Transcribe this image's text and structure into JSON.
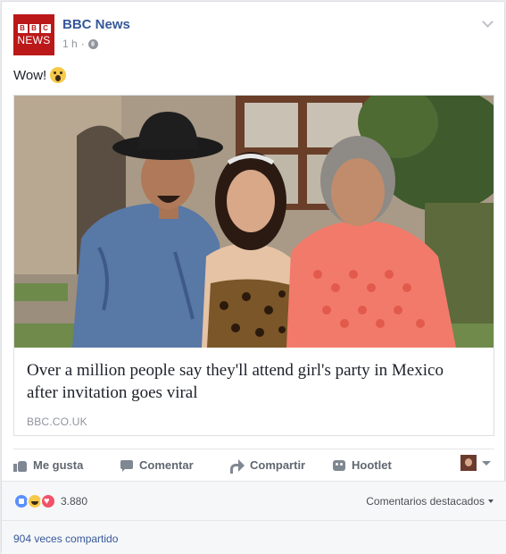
{
  "post": {
    "page_name": "BBC News",
    "avatar": {
      "logo_letters": [
        "B",
        "B",
        "C"
      ],
      "logo_word": "NEWS",
      "brand_color": "#bb1919"
    },
    "timestamp": "1 h",
    "separator": "·",
    "audience_icon": "globe-icon",
    "text": "Wow!",
    "text_emoji": "wow-emoji"
  },
  "link": {
    "title": "Over a million people say they'll attend girl's party in Mexico after invitation goes viral",
    "domain": "BBC.CO.UK"
  },
  "actions": {
    "like": "Me gusta",
    "comment": "Comentar",
    "share": "Compartir",
    "hootlet": "Hootlet"
  },
  "reactions": {
    "types": [
      "like",
      "haha",
      "love"
    ],
    "count": "3.880",
    "sort_label": "Comentarios destacados"
  },
  "shares": {
    "label": "904 veces compartido"
  },
  "colors": {
    "link_blue": "#365899",
    "muted": "#90949c",
    "background": "#e9ebee"
  }
}
